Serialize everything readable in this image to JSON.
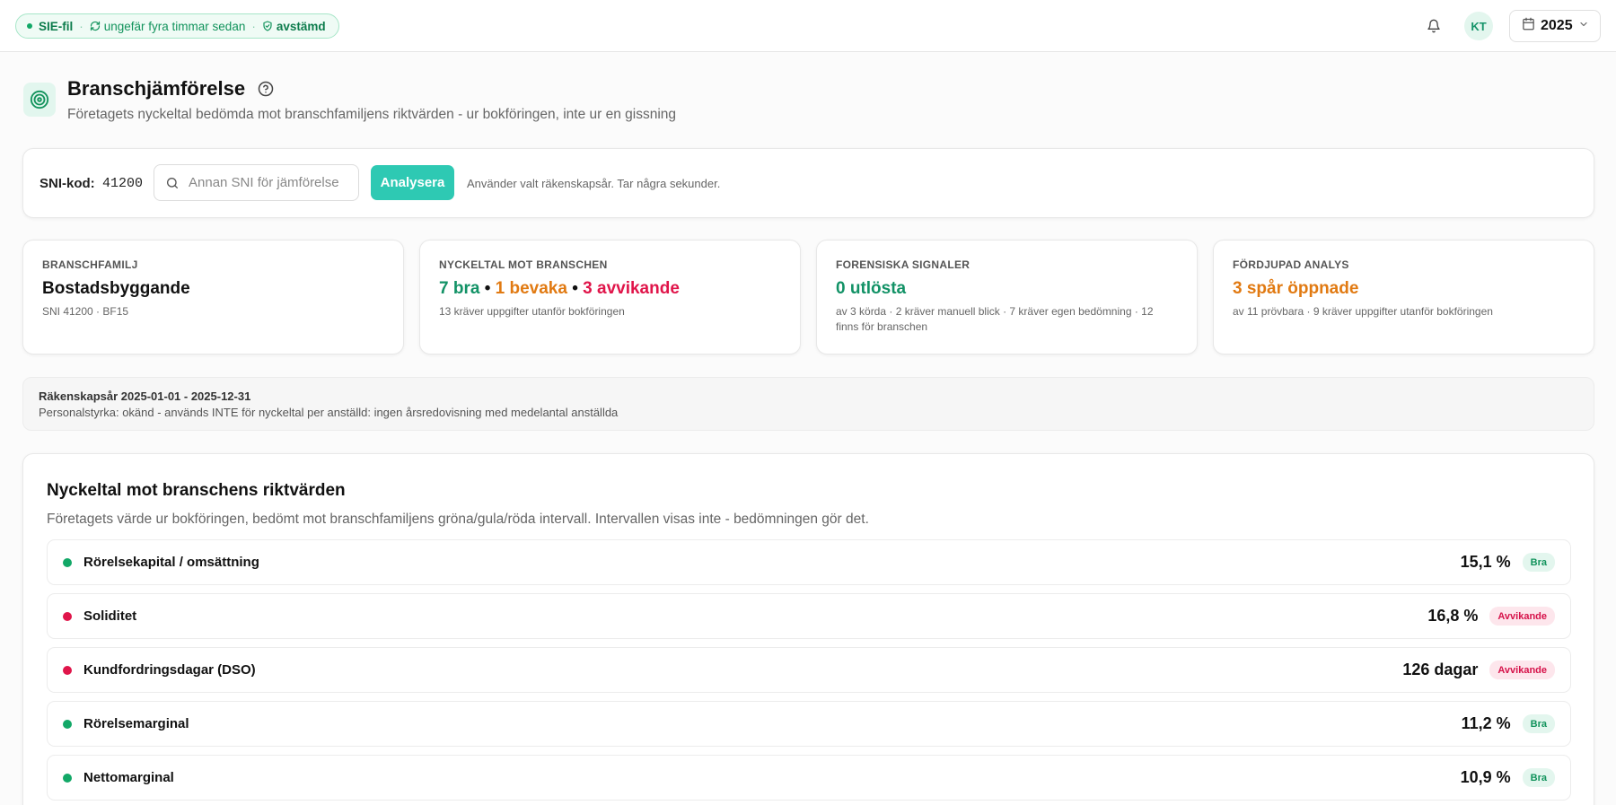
{
  "topbar": {
    "source_label": "SIE-fil",
    "sync_text": "ungefär fyra timmar sedan",
    "reconciled_label": "avstämd",
    "avatar_initials": "KT",
    "year": "2025"
  },
  "page": {
    "title": "Branschjämförelse",
    "subtitle": "Företagets nyckeltal bedömda mot branschfamiljens riktvärden - ur bokföringen, inte ur en gissning"
  },
  "sni": {
    "label": "SNI-kod:",
    "code": "41200",
    "input_placeholder": "Annan SNI för jämförelse",
    "analyze_label": "Analysera",
    "hint": "Använder valt räkenskapsår. Tar några sekunder."
  },
  "summary": {
    "family": {
      "label": "Branschfamilj",
      "value": "Bostadsbyggande",
      "sub": "SNI 41200 · BF15"
    },
    "keyfigures": {
      "label": "Nyckeltal mot branschen",
      "good": "7 bra",
      "watch": "1 bevaka",
      "deviating": "3 avvikande",
      "separator": "•",
      "sub": "13 kräver uppgifter utanför bokföringen"
    },
    "forensic": {
      "label": "Forensiska signaler",
      "value": "0 utlösta",
      "sub": "av 3 körda · 2 kräver manuell blick · 7 kräver egen bedömning · 12 finns för branschen"
    },
    "deep": {
      "label": "Fördjupad analys",
      "value": "3 spår öppnade",
      "sub": "av 11 prövbara · 9 kräver uppgifter utanför bokföringen"
    }
  },
  "info": {
    "fiscal_year": "Räkenskapsår 2025-01-01 - 2025-12-31",
    "staffing": "Personalstyrka: okänd - används INTE för nyckeltal per anställd: ingen årsredovisning med medelantal anställda"
  },
  "keyfigures": {
    "title": "Nyckeltal mot branschens riktvärden",
    "subtitle": "Företagets värde ur bokföringen, bedömt mot branschfamiljens gröna/gula/röda intervall. Intervallen visas inte - bedömningen gör det.",
    "rows": [
      {
        "name": "Rörelsekapital / omsättning",
        "value": "15,1 %",
        "status": "Bra"
      },
      {
        "name": "Soliditet",
        "value": "16,8 %",
        "status": "Avvikande"
      },
      {
        "name": "Kundfordringsdagar (DSO)",
        "value": "126 dagar",
        "status": "Avvikande"
      },
      {
        "name": "Rörelsemarginal",
        "value": "11,2 %",
        "status": "Bra"
      },
      {
        "name": "Nettomarginal",
        "value": "10,9 %",
        "status": "Bra"
      }
    ]
  },
  "colors": {
    "good": "#12a867",
    "bad": "#e0154a",
    "accent": "#2ec9b3"
  }
}
